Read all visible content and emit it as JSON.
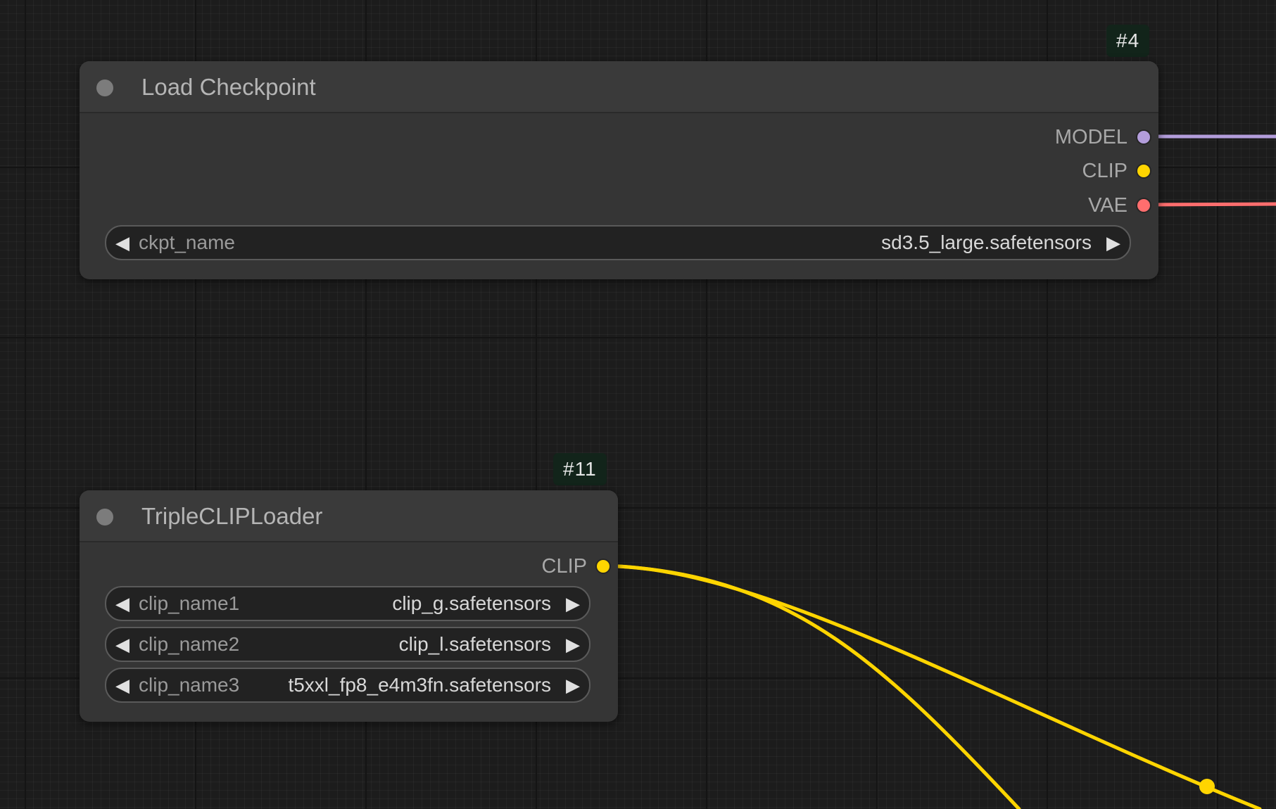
{
  "nodes": {
    "load_checkpoint": {
      "id_badge": "#4",
      "title": "Load Checkpoint",
      "outputs": [
        {
          "label": "MODEL",
          "color": "#b39ddb"
        },
        {
          "label": "CLIP",
          "color": "#ffd500"
        },
        {
          "label": "VAE",
          "color": "#ff6e6e"
        }
      ],
      "widgets": [
        {
          "name": "ckpt_name",
          "value": "sd3.5_large.safetensors"
        }
      ]
    },
    "triple_clip_loader": {
      "id_badge": "#11",
      "title": "TripleCLIPLoader",
      "outputs": [
        {
          "label": "CLIP",
          "color": "#ffd500"
        }
      ],
      "widgets": [
        {
          "name": "clip_name1",
          "value": "clip_g.safetensors"
        },
        {
          "name": "clip_name2",
          "value": "clip_l.safetensors"
        },
        {
          "name": "clip_name3",
          "value": "t5xxl_fp8_e4m3fn.safetensors"
        }
      ]
    }
  },
  "icons": {
    "widget_decrement": "◀",
    "widget_increment": "▶"
  },
  "colors": {
    "canvas_background": "#1c1c1c",
    "node_body": "#353535",
    "model_link": "#b39ddb",
    "clip_link": "#ffd500",
    "vae_link": "#ff6e6e"
  }
}
